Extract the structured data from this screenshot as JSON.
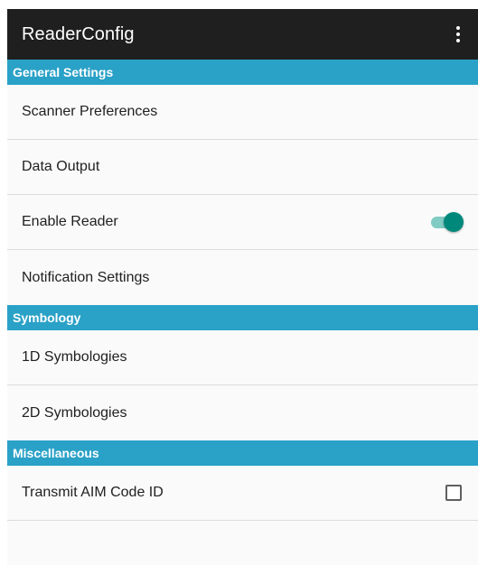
{
  "app_bar": {
    "title": "ReaderConfig",
    "overflow_icon": "more-vert-icon"
  },
  "sections": [
    {
      "header": "General Settings",
      "items": [
        {
          "label": "Scanner Preferences"
        },
        {
          "label": "Data Output"
        },
        {
          "label": "Enable Reader",
          "control": "switch",
          "checked": true
        },
        {
          "label": "Notification Settings"
        }
      ]
    },
    {
      "header": "Symbology",
      "items": [
        {
          "label": "1D Symbologies"
        },
        {
          "label": "2D Symbologies"
        }
      ]
    },
    {
      "header": "Miscellaneous",
      "items": [
        {
          "label": "Transmit AIM Code ID",
          "control": "checkbox",
          "checked": false
        }
      ]
    }
  ],
  "colors": {
    "app_bar": "#1f1f1f",
    "section_header": "#2aa1c7",
    "switch_on": "#00897b",
    "switch_track": "#80cbc4"
  }
}
